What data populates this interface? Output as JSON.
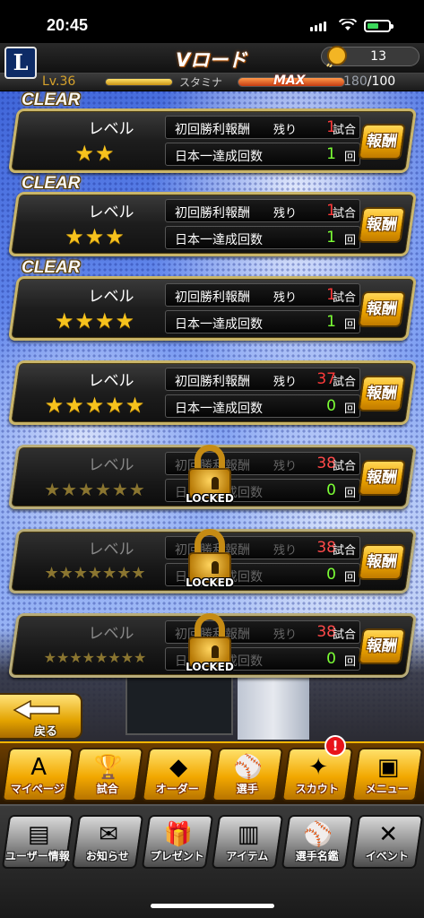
{
  "status_bar": {
    "time": "20:45"
  },
  "header": {
    "title": "Vロード",
    "logo_letter": "L",
    "currency_count": "13"
  },
  "stats": {
    "level_label": "Lv.36",
    "stamina_label": "スタミナ",
    "stamina_state": "MAX",
    "stamina_current": "180",
    "stamina_max": "/100"
  },
  "rows": [
    {
      "clear": "CLEAR",
      "level_label": "レベル",
      "stars": "★★",
      "first_win_label": "初回勝利報酬",
      "remaining_label": "残り",
      "remaining_value": "1",
      "remaining_unit": "試合",
      "champion_label": "日本一達成回数",
      "champion_value": "1",
      "champion_unit": "回",
      "reward_label": "報酬",
      "locked": ""
    },
    {
      "clear": "CLEAR",
      "level_label": "レベル",
      "stars": "★★★",
      "first_win_label": "初回勝利報酬",
      "remaining_label": "残り",
      "remaining_value": "1",
      "remaining_unit": "試合",
      "champion_label": "日本一達成回数",
      "champion_value": "1",
      "champion_unit": "回",
      "reward_label": "報酬",
      "locked": ""
    },
    {
      "clear": "CLEAR",
      "level_label": "レベル",
      "stars": "★★★★",
      "first_win_label": "初回勝利報酬",
      "remaining_label": "残り",
      "remaining_value": "1",
      "remaining_unit": "試合",
      "champion_label": "日本一達成回数",
      "champion_value": "1",
      "champion_unit": "回",
      "reward_label": "報酬",
      "locked": ""
    },
    {
      "clear": "",
      "level_label": "レベル",
      "stars": "★★★★★",
      "first_win_label": "初回勝利報酬",
      "remaining_label": "残り",
      "remaining_value": "37",
      "remaining_unit": "試合",
      "champion_label": "日本一達成回数",
      "champion_value": "0",
      "champion_unit": "回",
      "reward_label": "報酬",
      "locked": ""
    },
    {
      "clear": "",
      "level_label": "レベル",
      "stars": "★★★★★★",
      "first_win_label": "初回勝利報酬",
      "remaining_label": "残り",
      "remaining_value": "38",
      "remaining_unit": "試合",
      "champion_label": "日本一達成回数",
      "champion_value": "0",
      "champion_unit": "回",
      "reward_label": "報酬",
      "locked": "LOCKED"
    },
    {
      "clear": "",
      "level_label": "レベル",
      "stars": "★★★★★★★",
      "first_win_label": "初回勝利報酬",
      "remaining_label": "残り",
      "remaining_value": "38",
      "remaining_unit": "試合",
      "champion_label": "日本一達成回数",
      "champion_value": "0",
      "champion_unit": "回",
      "reward_label": "報酬",
      "locked": "LOCKED"
    },
    {
      "clear": "",
      "level_label": "レベル",
      "stars": "★★★★★★★★",
      "first_win_label": "初回勝利報酬",
      "remaining_label": "残り",
      "remaining_value": "38",
      "remaining_unit": "試合",
      "champion_label": "日本一達成回数",
      "champion_value": "0",
      "champion_unit": "回",
      "reward_label": "報酬",
      "locked": "LOCKED"
    }
  ],
  "back": {
    "label": "戻る"
  },
  "nav_main": [
    {
      "label": "マイページ",
      "icon": "home-icon",
      "glyph": "A"
    },
    {
      "label": "試合",
      "icon": "trophy-icon",
      "glyph": "🏆"
    },
    {
      "label": "オーダー",
      "icon": "field-icon",
      "glyph": "◆"
    },
    {
      "label": "選手",
      "icon": "player-icon",
      "glyph": "⚾"
    },
    {
      "label": "スカウト",
      "icon": "scout-icon",
      "glyph": "✦"
    },
    {
      "label": "メニュー",
      "icon": "menu-icon",
      "glyph": "▣"
    }
  ],
  "scout_badge": "!",
  "nav_sub": [
    {
      "label": "ユーザー情報",
      "icon": "user-card-icon",
      "glyph": "▤"
    },
    {
      "label": "お知らせ",
      "icon": "notice-icon",
      "glyph": "✉"
    },
    {
      "label": "プレゼント",
      "icon": "gift-icon",
      "glyph": "🎁"
    },
    {
      "label": "アイテム",
      "icon": "item-icon",
      "glyph": "▥"
    },
    {
      "label": "選手名鑑",
      "icon": "player-book-icon",
      "glyph": "⚾"
    },
    {
      "label": "イベント",
      "icon": "event-icon",
      "glyph": "✕"
    }
  ],
  "colors": {
    "accent": "#f2a800",
    "locked_text": "#888888",
    "remaining_red": "#ff3a3a",
    "count_green": "#7cff35"
  }
}
